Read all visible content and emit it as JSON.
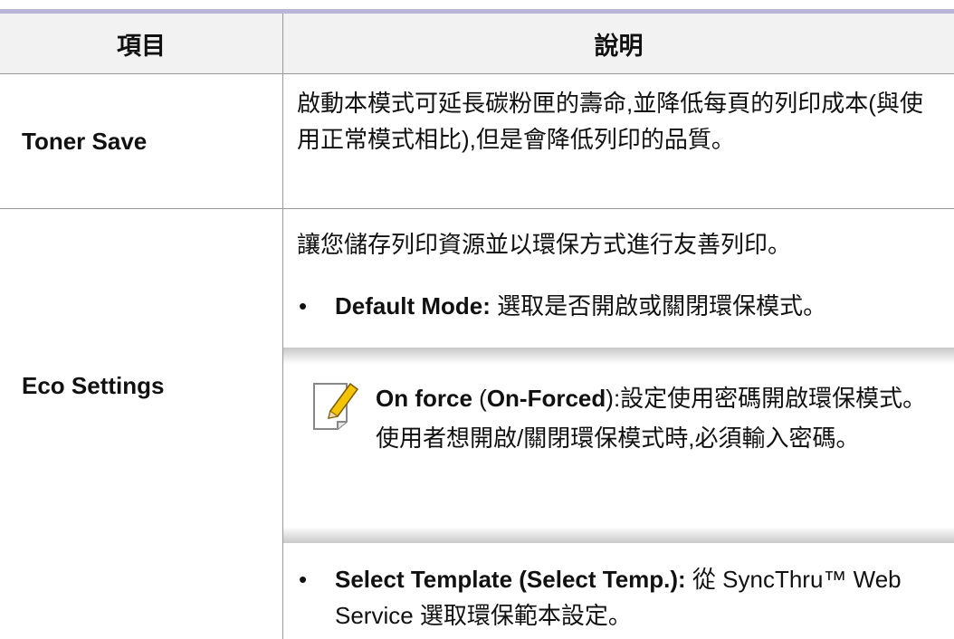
{
  "header": {
    "col_item": "項目",
    "col_desc": "說明"
  },
  "rows": [
    {
      "item": "Toner Save",
      "desc": "啟動本模式可延長碳粉匣的壽命,並降低每頁的列印成本(與使用正常模式相比),但是會降低列印的品質。"
    },
    {
      "item": "Eco Settings",
      "intro": "讓您儲存列印資源並以環保方式進行友善列印。",
      "bullets": [
        {
          "label": "Default Mode:",
          "text": " 選取是否開啟或關閉環保模式。"
        },
        {
          "label": "Select Template (Select Temp.):",
          "text": " 從 SyncThru™ Web Service 選取環保範本設定。"
        }
      ],
      "note": {
        "icon": "note-pencil-icon",
        "label_a": "On force",
        "label_b_open": " (",
        "label_b": "On-Forced",
        "label_b_close": ")",
        "text": ":設定使用密碼開啟環保模式。使用者想開啟/關閉環保模式時,必須輸入密碼。"
      }
    }
  ],
  "bullet_symbol": "•"
}
